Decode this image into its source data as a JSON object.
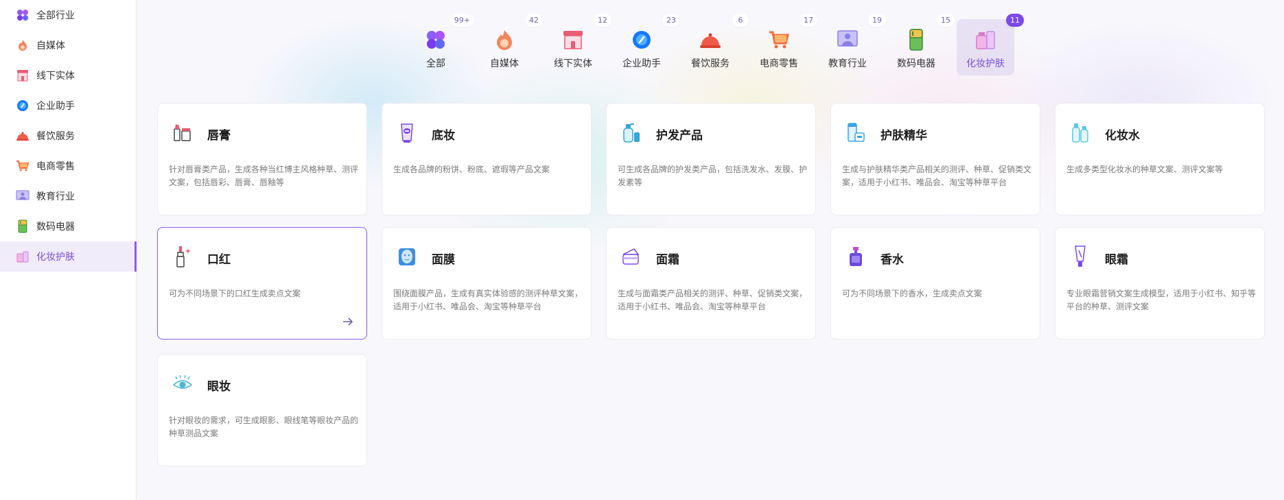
{
  "sidebar": {
    "items": [
      {
        "label": "全部行业",
        "icon": "clover-icon"
      },
      {
        "label": "自媒体",
        "icon": "flame-icon"
      },
      {
        "label": "线下实体",
        "icon": "storefront-icon"
      },
      {
        "label": "企业助手",
        "icon": "gear-chip-icon"
      },
      {
        "label": "餐饮服务",
        "icon": "cloche-icon"
      },
      {
        "label": "电商零售",
        "icon": "shopping-cart-icon"
      },
      {
        "label": "教育行业",
        "icon": "teacher-board-icon"
      },
      {
        "label": "数码电器",
        "icon": "fridge-icon"
      },
      {
        "label": "化妆护肤",
        "icon": "cosmetics-icon"
      }
    ],
    "active_index": 8
  },
  "tabs": [
    {
      "label": "全部",
      "count": "99+",
      "icon": "clover-icon"
    },
    {
      "label": "自媒体",
      "count": "42",
      "icon": "flame-icon"
    },
    {
      "label": "线下实体",
      "count": "12",
      "icon": "storefront-icon"
    },
    {
      "label": "企业助手",
      "count": "23",
      "icon": "gear-chip-icon"
    },
    {
      "label": "餐饮服务",
      "count": "6",
      "icon": "cloche-icon"
    },
    {
      "label": "电商零售",
      "count": "17",
      "icon": "shopping-cart-icon"
    },
    {
      "label": "教育行业",
      "count": "19",
      "icon": "teacher-board-icon"
    },
    {
      "label": "数码电器",
      "count": "15",
      "icon": "fridge-icon"
    },
    {
      "label": "化妆护肤",
      "count": "11",
      "icon": "cosmetics-icon"
    }
  ],
  "cards": [
    {
      "title": "唇膏",
      "icon": "lip-balm-icon",
      "desc": "针对唇膏类产品，生成各种当红博主风格种草、测评文案，包括唇彩、唇膏、唇釉等"
    },
    {
      "title": "底妆",
      "icon": "foundation-tube-icon",
      "desc": "生成各品牌的粉饼、粉底、遮瑕等产品文案"
    },
    {
      "title": "护发产品",
      "icon": "shampoo-bottle-icon",
      "desc": "可生成各品牌的护发类产品，包括洗发水、发膜、护发素等"
    },
    {
      "title": "护肤精华",
      "icon": "serum-jar-icon",
      "desc": "生成与护肤精华类产品相关的测评、种草、促销类文案，适用于小红书、唯品会、淘宝等种草平台"
    },
    {
      "title": "化妆水",
      "icon": "toner-bottles-icon",
      "desc": "生成多类型化妆水的种草文案、测评文案等"
    },
    {
      "title": "口红",
      "icon": "lipstick-icon",
      "desc": "可为不同场景下的口红生成卖点文案"
    },
    {
      "title": "面膜",
      "icon": "face-mask-icon",
      "desc": "围绕面膜产品，生成有真实体验感的测评种草文案，适用于小红书、唯品会、淘宝等种草平台"
    },
    {
      "title": "面霜",
      "icon": "cream-jar-icon",
      "desc": "生成与面霜类产品相关的测评、种草、促销类文案，适用于小红书、唯品会、淘宝等种草平台"
    },
    {
      "title": "香水",
      "icon": "perfume-bottle-icon",
      "desc": "可为不同场景下的香水，生成卖点文案"
    },
    {
      "title": "眼霜",
      "icon": "eye-cream-tube-icon",
      "desc": "专业眼霜营销文案生成模型，适用于小红书、知乎等平台的种草、测评文案"
    },
    {
      "title": "眼妆",
      "icon": "eye-makeup-icon",
      "desc": "针对眼妆的需求，可生成眼影、眼线笔等眼妆产品的种草测品文案"
    }
  ],
  "active_card_index": 5,
  "colors": {
    "accent": "#7b49e8",
    "active_text": "#7b4fd6"
  }
}
